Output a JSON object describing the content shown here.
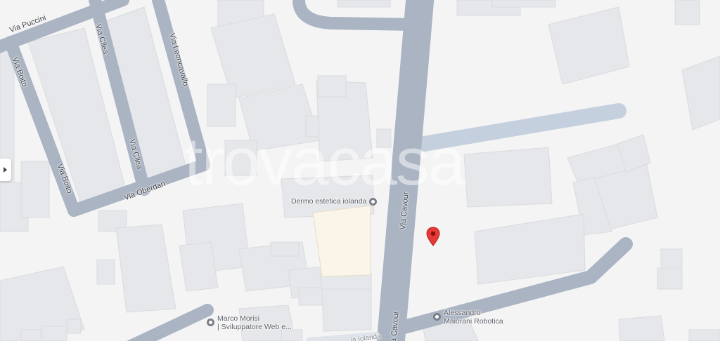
{
  "map": {
    "colors": {
      "background": "#f4f4f5",
      "building": "#e6e7ea",
      "building_outline": "#d9dadd",
      "road": "#aab4c3",
      "road_light": "#c4d0de",
      "highlighted_parcel": "#fbf5e9",
      "pin": "#e53935"
    },
    "watermark": "trovacasa",
    "streets": {
      "via_puccini": "Via Puccini",
      "via_boito_upper": "Via Boito",
      "via_cilea_upper": "Via Cilea",
      "via_leoncavallo": "Via Leoncavallo",
      "via_cilea_lower": "Via Cilea",
      "via_boito_lower": "Via Boito",
      "via_oberdan": "Via Oberdan",
      "via_cavour": "Via Cavour",
      "via_iolanda_partial": "ia Iolanda"
    },
    "pois": [
      {
        "name": "Dermo estetica iolanda"
      },
      {
        "name": "Marco Morisi",
        "subtitle": "| Sviluppatore Web e..."
      },
      {
        "name": "Alessandro",
        "subtitle": "Maiorani Robotica"
      }
    ],
    "controls": {
      "side_panel_toggle": "chevron-right-icon",
      "location_marker": "map-pin-icon"
    }
  }
}
